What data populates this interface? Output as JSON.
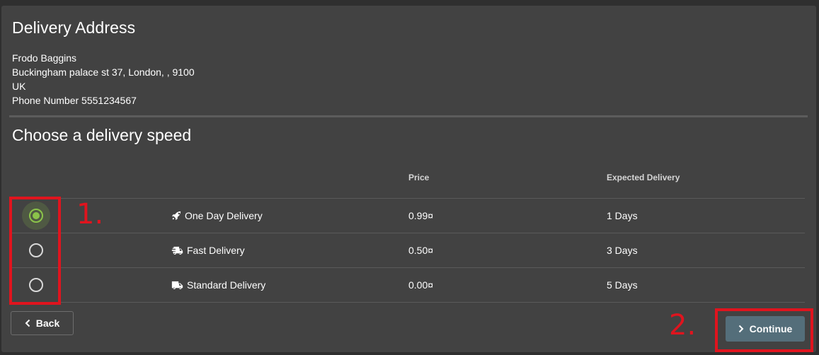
{
  "address": {
    "title": "Delivery Address",
    "name": "Frodo Baggins",
    "street": "Buckingham palace st 37, London, , 9100",
    "country": "UK",
    "phone": "Phone Number 5551234567"
  },
  "delivery": {
    "title": "Choose a delivery speed",
    "headers": {
      "price": "Price",
      "expected": "Expected Delivery"
    },
    "options": [
      {
        "name": "One Day Delivery",
        "price": "0.99¤",
        "days": "1 Days",
        "selected": true,
        "icon": "rocket-icon"
      },
      {
        "name": "Fast Delivery",
        "price": "0.50¤",
        "days": "3 Days",
        "selected": false,
        "icon": "shipping-fast-icon"
      },
      {
        "name": "Standard Delivery",
        "price": "0.00¤",
        "days": "5 Days",
        "selected": false,
        "icon": "truck-icon"
      }
    ]
  },
  "buttons": {
    "back": "Back",
    "continue": "Continue"
  },
  "annotations": {
    "step1": "1.",
    "step2": "2."
  },
  "colors": {
    "accent": "#8bc34a",
    "annotation": "#e0141e",
    "primary_button": "#546e7a"
  }
}
